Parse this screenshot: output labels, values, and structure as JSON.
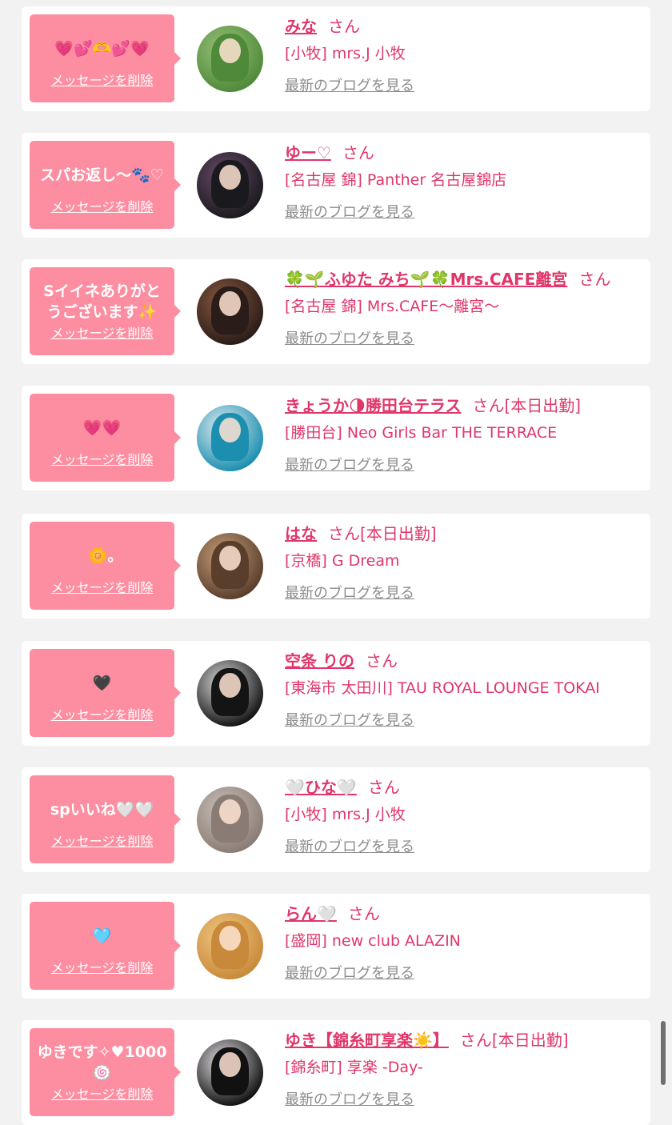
{
  "messages": [
    {
      "message": "💗💕🫶💕💗",
      "delete_label": "メッセージを削除",
      "name": "みな",
      "honorific": "さん",
      "status": "",
      "shop": "[小牧] mrs.J 小牧",
      "blog_label": "最新のブログを見る",
      "avatar_colors": [
        "#4f8a3a",
        "#9ac27a"
      ]
    },
    {
      "message": "スパお返し〜🐾♡",
      "delete_label": "メッセージを削除",
      "name": "ゆー♡",
      "honorific": "さん",
      "status": "",
      "shop": "[名古屋 錦] Panther 名古屋錦店",
      "blog_label": "最新のブログを見る",
      "avatar_colors": [
        "#1a1a1e",
        "#6a4a6a"
      ]
    },
    {
      "message": "Sイイネありがとうございます✨",
      "delete_label": "メッセージを削除",
      "name": "🍀🌱ふゆた みち🌱🍀Mrs.CAFE離宮",
      "honorific": "さん",
      "status": "",
      "shop": "[名古屋 錦] Mrs.CAFE〜離宮〜",
      "blog_label": "最新のブログを見る",
      "avatar_colors": [
        "#2a1c18",
        "#8a5a40"
      ]
    },
    {
      "message": "💗💗",
      "delete_label": "メッセージを削除",
      "name": "きょうか🌗勝田台テラス",
      "honorific": "さん",
      "status": "[本日出勤]",
      "shop": "[勝田台] Neo Girls Bar THE TERRACE",
      "blog_label": "最新のブログを見る",
      "avatar_colors": [
        "#1c8fb0",
        "#e6eef2"
      ]
    },
    {
      "message": "🌼｡",
      "delete_label": "メッセージを削除",
      "name": "はな",
      "honorific": "さん",
      "status": "[本日出勤]",
      "shop": "[京橋] G Dream",
      "blog_label": "最新のブログを見る",
      "avatar_colors": [
        "#5a3e2c",
        "#c8a07a"
      ]
    },
    {
      "message": "🖤",
      "delete_label": "メッセージを削除",
      "name": "空条 りの",
      "honorific": "さん",
      "status": "",
      "shop": "[東海市 太田川] TAU ROYAL LOUNGE TOKAI",
      "blog_label": "最新のブログを見る",
      "avatar_colors": [
        "#141414",
        "#dedede"
      ]
    },
    {
      "message": "spいいね🤍🤍",
      "delete_label": "メッセージを削除",
      "name": "🤍ひな🤍",
      "honorific": "さん",
      "status": "",
      "shop": "[小牧] mrs.J 小牧",
      "blog_label": "最新のブログを見る",
      "avatar_colors": [
        "#8a7c74",
        "#cac2bc"
      ]
    },
    {
      "message": "🩵",
      "delete_label": "メッセージを削除",
      "name": "らん🤍",
      "honorific": "さん",
      "status": "",
      "shop": "[盛岡] new club ALAZIN",
      "blog_label": "最新のブログを見る",
      "avatar_colors": [
        "#c88a3a",
        "#f2c884"
      ]
    },
    {
      "message": "ゆきです✧♥1000🍥",
      "delete_label": "メッセージを削除",
      "name": "ゆき【錦糸町享楽☀️】",
      "honorific": "さん",
      "status": "[本日出勤]",
      "shop": "[錦糸町] 享楽 -Day-",
      "blog_label": "最新のブログを見る",
      "avatar_colors": [
        "#111111",
        "#e8e4e8"
      ]
    }
  ]
}
